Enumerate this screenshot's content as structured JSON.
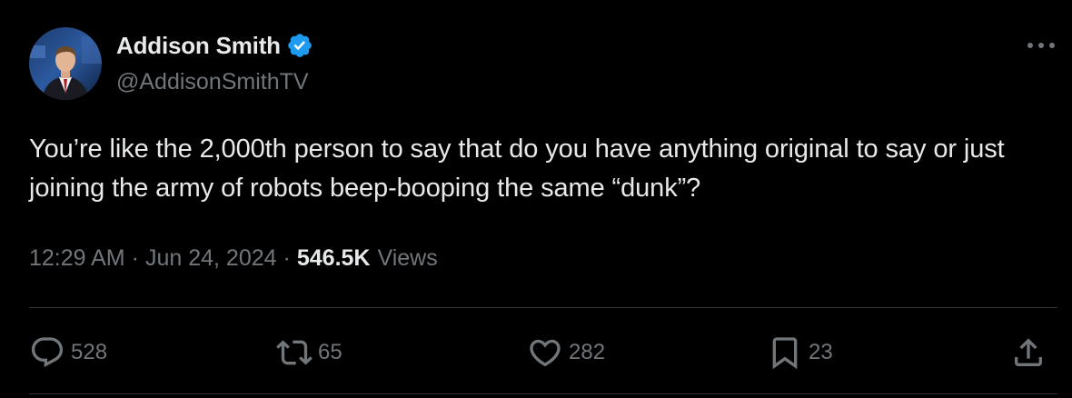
{
  "author": {
    "display_name": "Addison Smith",
    "handle": "@AddisonSmithTV",
    "verified": true
  },
  "tweet": {
    "text": "You’re like the 2,000th person to say that do you have anything original to say or just joining the army of robots beep-booping the same “dunk”?",
    "time": "12:29 AM",
    "date": "Jun 24, 2024",
    "separator": "·",
    "views_count": "546.5K",
    "views_label": "Views"
  },
  "actions": {
    "replies": "528",
    "retweets": "65",
    "likes": "282",
    "bookmarks": "23"
  },
  "icons": {
    "more": "more-horizontal-icon",
    "reply": "reply-icon",
    "retweet": "retweet-icon",
    "like": "heart-icon",
    "bookmark": "bookmark-icon",
    "share": "share-icon",
    "verified": "verified-badge-icon"
  },
  "colors": {
    "background": "#000000",
    "text": "#e7e9ea",
    "secondary": "#71767b",
    "verified": "#1d9bf0",
    "divider": "#2f3336"
  }
}
